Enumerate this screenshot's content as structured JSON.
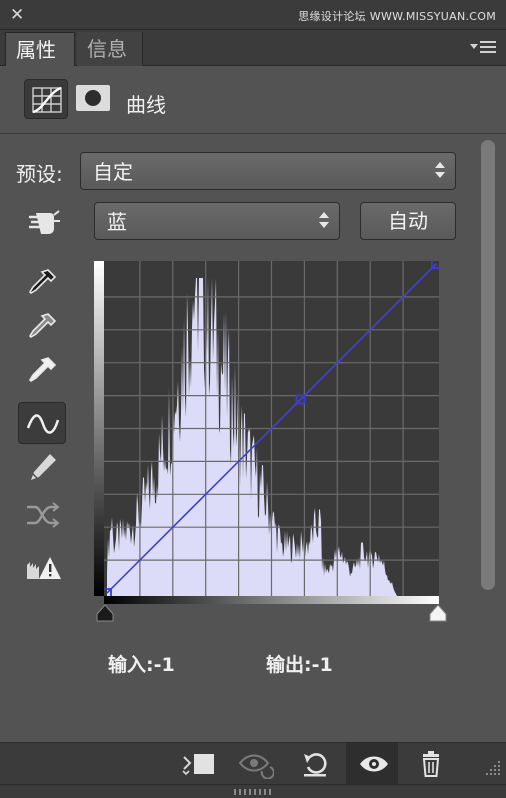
{
  "window": {
    "close_icon": "close-icon",
    "watermark": "思缘设计论坛 WWW.MISSYUAN.COM"
  },
  "tabs": [
    {
      "label": "属性",
      "active": true
    },
    {
      "label": "信息",
      "active": false
    }
  ],
  "header": {
    "title": "曲线",
    "icons": [
      "curves-adjustment-icon",
      "layer-mask-icon"
    ]
  },
  "preset": {
    "label": "预设:",
    "value": "自定"
  },
  "channel": {
    "value": "蓝"
  },
  "auto_button": "自动",
  "tools": [
    "on-image-adjust-icon",
    "black-point-eyedropper-icon",
    "gray-point-eyedropper-icon",
    "white-point-eyedropper-icon",
    "curve-points-icon",
    "pencil-icon",
    "smooth-icon",
    "clipping-warning-icon"
  ],
  "curve": {
    "channel_color": "#3b3bd6",
    "histogram_color": "#dcdcf8",
    "points": [
      [
        0,
        0
      ],
      [
        150,
        150
      ],
      [
        255,
        255
      ]
    ]
  },
  "readout": {
    "input": "输入:-1",
    "output": "输出:-1"
  },
  "footer_icons": [
    "clip-to-layer-icon",
    "view-previous-state-icon",
    "reset-icon",
    "visibility-eye-icon",
    "delete-icon"
  ]
}
